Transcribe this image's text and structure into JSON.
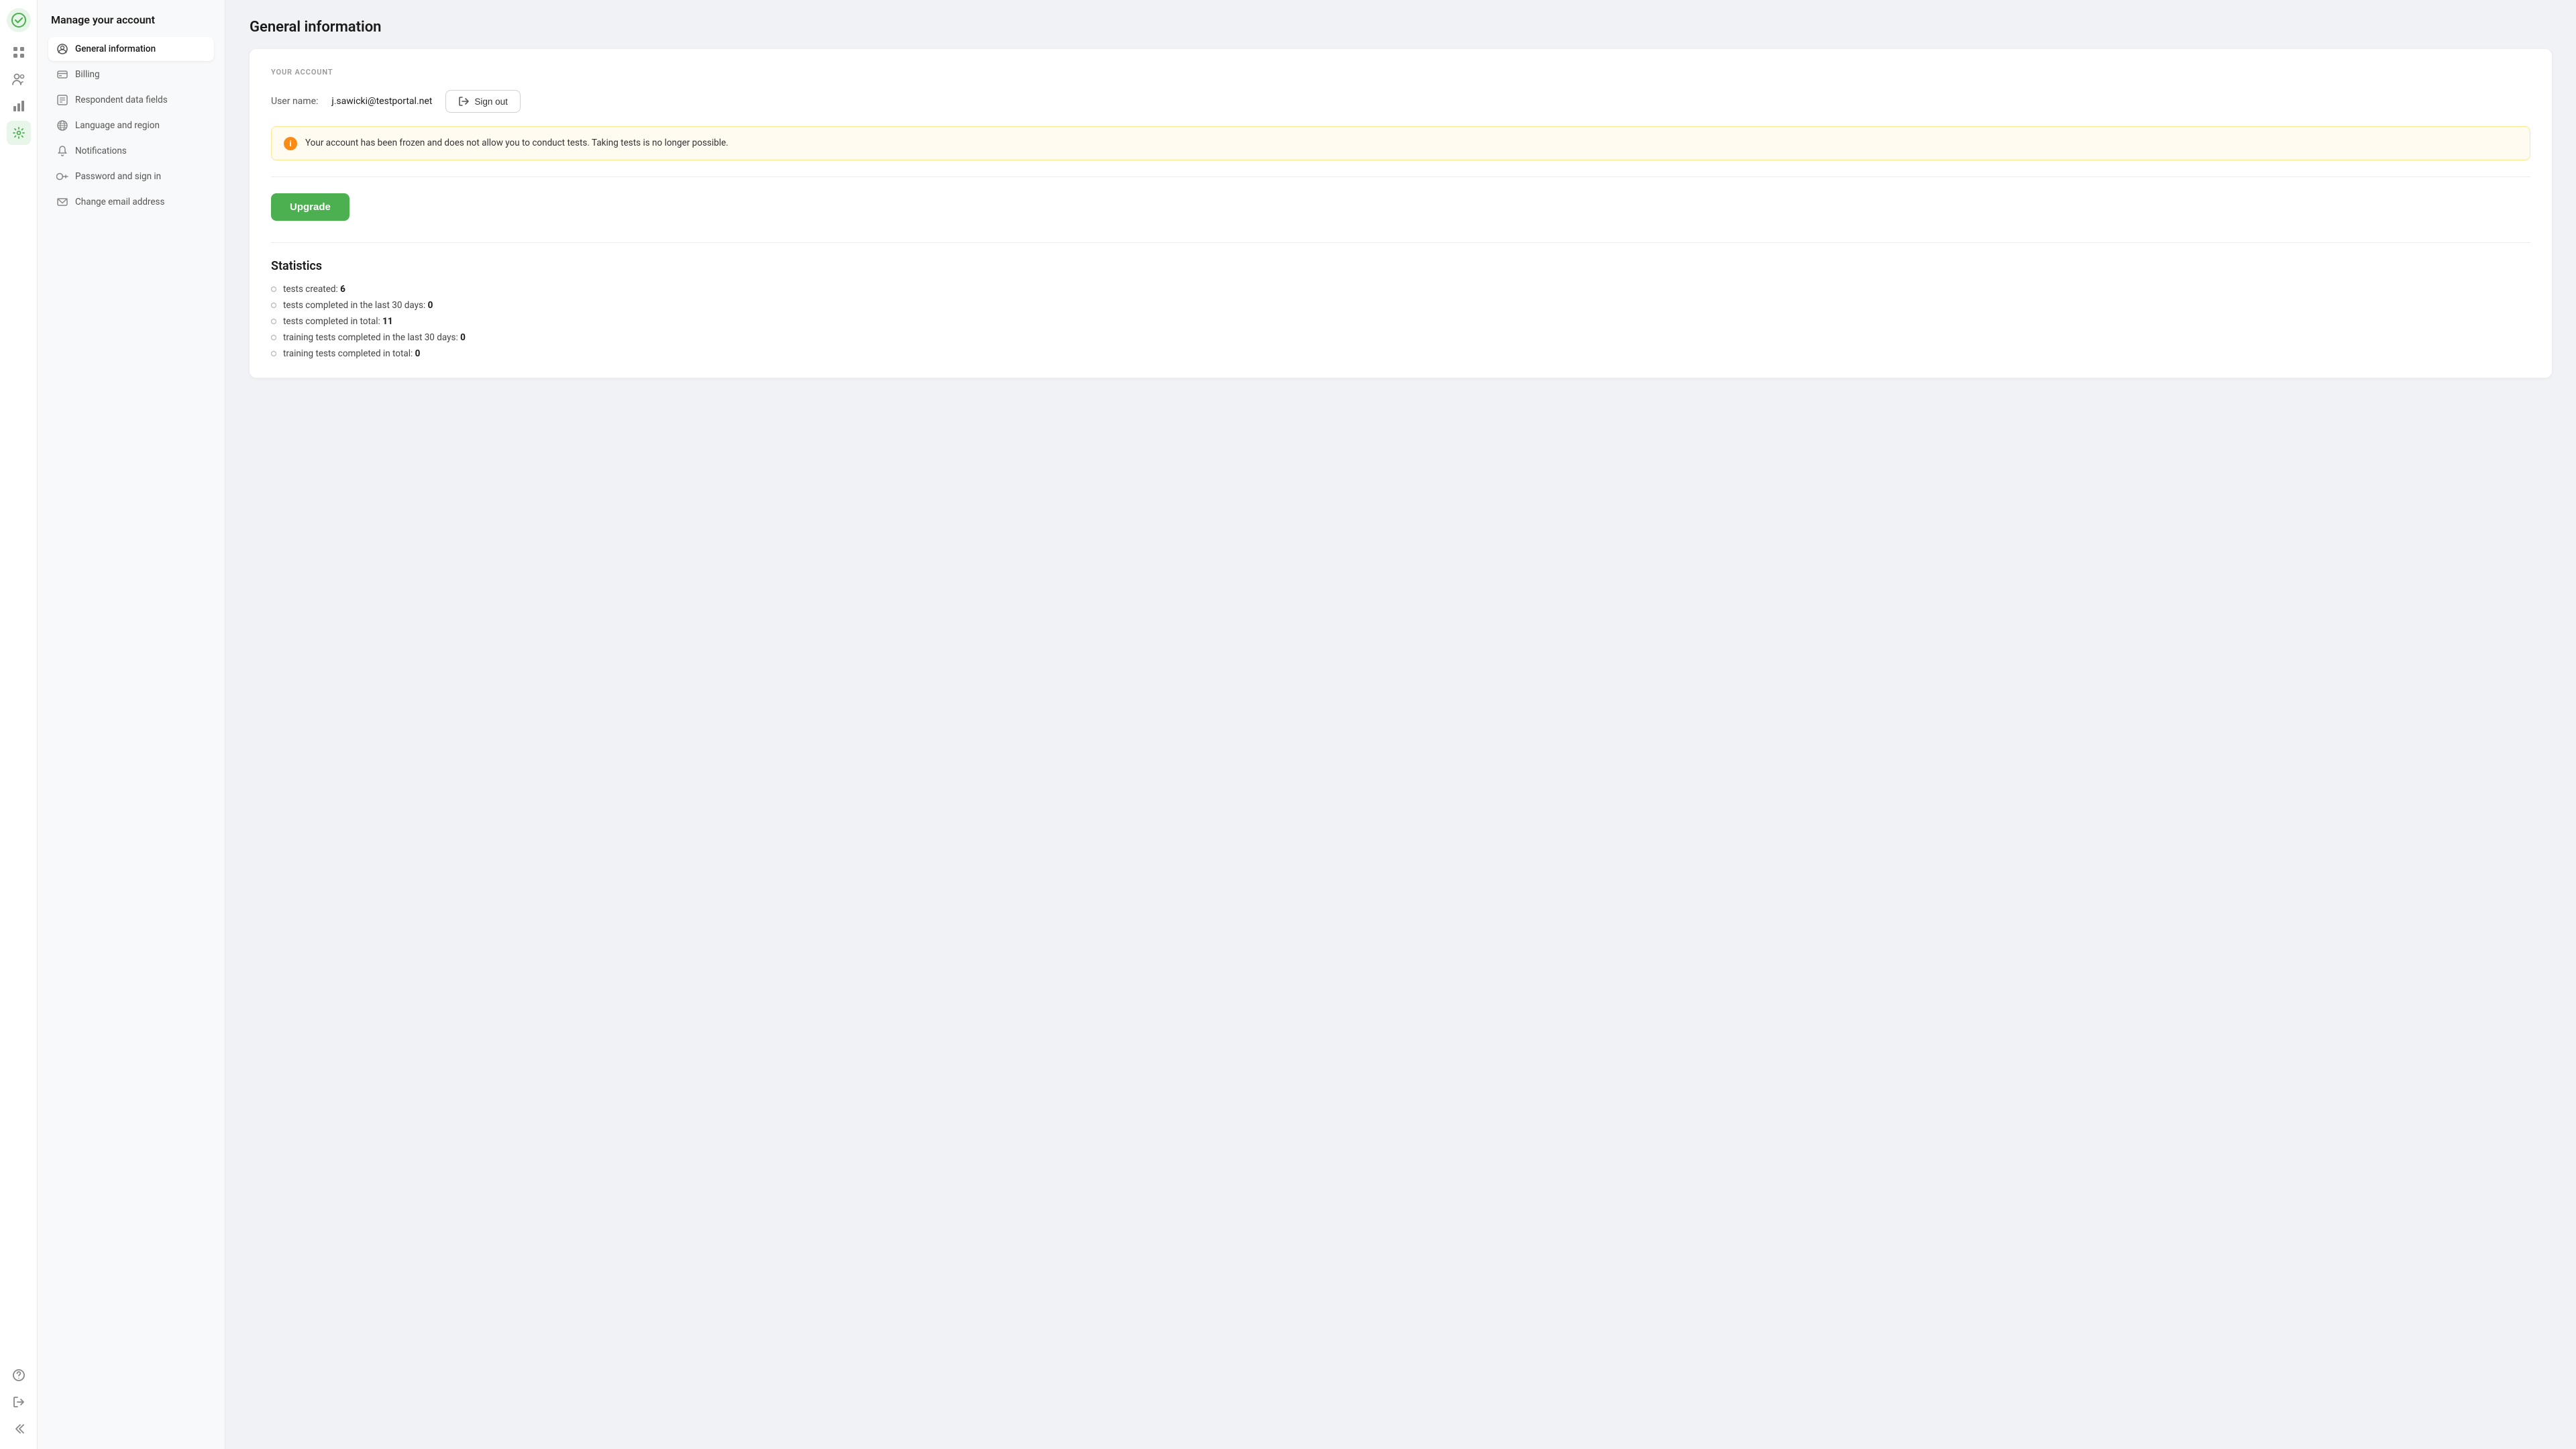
{
  "iconbar": {
    "items": [
      {
        "name": "logo",
        "icon": "✓",
        "active": true
      },
      {
        "name": "grid",
        "icon": "⊞",
        "active": false
      },
      {
        "name": "users",
        "icon": "👥",
        "active": false
      },
      {
        "name": "chart",
        "icon": "📊",
        "active": false
      },
      {
        "name": "settings",
        "icon": "⚙",
        "active": true
      },
      {
        "name": "help",
        "icon": "?",
        "active": false
      },
      {
        "name": "signout",
        "icon": "←",
        "active": false
      },
      {
        "name": "collapse",
        "icon": "»",
        "active": false
      }
    ]
  },
  "sidebar": {
    "title": "Manage your account",
    "nav": [
      {
        "id": "general",
        "label": "General information",
        "active": true
      },
      {
        "id": "billing",
        "label": "Billing",
        "active": false
      },
      {
        "id": "respondent",
        "label": "Respondent data fields",
        "active": false
      },
      {
        "id": "language",
        "label": "Language and region",
        "active": false
      },
      {
        "id": "notifications",
        "label": "Notifications",
        "active": false
      },
      {
        "id": "password",
        "label": "Password and sign in",
        "active": false
      },
      {
        "id": "email",
        "label": "Change email address",
        "active": false
      }
    ]
  },
  "main": {
    "page_title": "General information",
    "your_account": {
      "section_label": "YOUR ACCOUNT",
      "username_label": "User name:",
      "username_value": "j.sawicki@testportal.net",
      "sign_out_label": "Sign out",
      "warning_message": "Your account has been frozen and does not allow you to conduct tests. Taking tests is no longer possible.",
      "upgrade_label": "Upgrade"
    },
    "statistics": {
      "title": "Statistics",
      "items": [
        {
          "text": "tests created: ",
          "bold": "6"
        },
        {
          "text": "tests completed in the last 30 days: ",
          "bold": "0"
        },
        {
          "text": "tests completed in total: ",
          "bold": "11"
        },
        {
          "text": "training tests completed in the last 30 days: ",
          "bold": "0"
        },
        {
          "text": "training tests completed in total: ",
          "bold": "0"
        }
      ]
    }
  },
  "colors": {
    "green": "#4caf50",
    "orange": "#fa8c16",
    "warning_bg": "#fffbf0",
    "warning_border": "#ffe58f"
  }
}
